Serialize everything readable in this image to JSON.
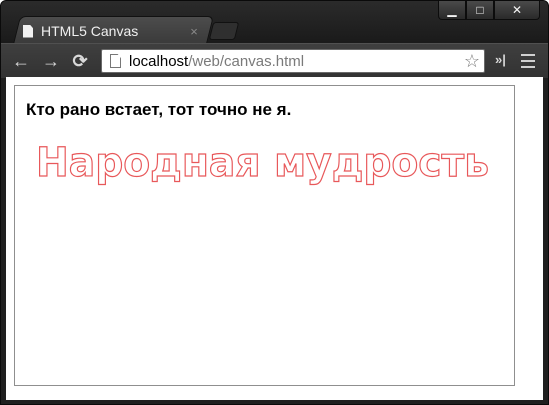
{
  "tab": {
    "title": "HTML5 Canvas",
    "close_glyph": "×"
  },
  "window_controls": {
    "minimize": "▁",
    "maximize": "□",
    "close": "✕"
  },
  "toolbar": {
    "back_glyph": "←",
    "forward_glyph": "→",
    "reload_glyph": "⟳",
    "url_host": "localhost",
    "url_path": "/web/canvas.html",
    "star_glyph": "☆",
    "extensions_glyph": "»|"
  },
  "canvas": {
    "line1": "Кто рано встает, тот точно не я.",
    "line2": "Народная мудрость",
    "line2_stroke_color": "#e8585a"
  }
}
